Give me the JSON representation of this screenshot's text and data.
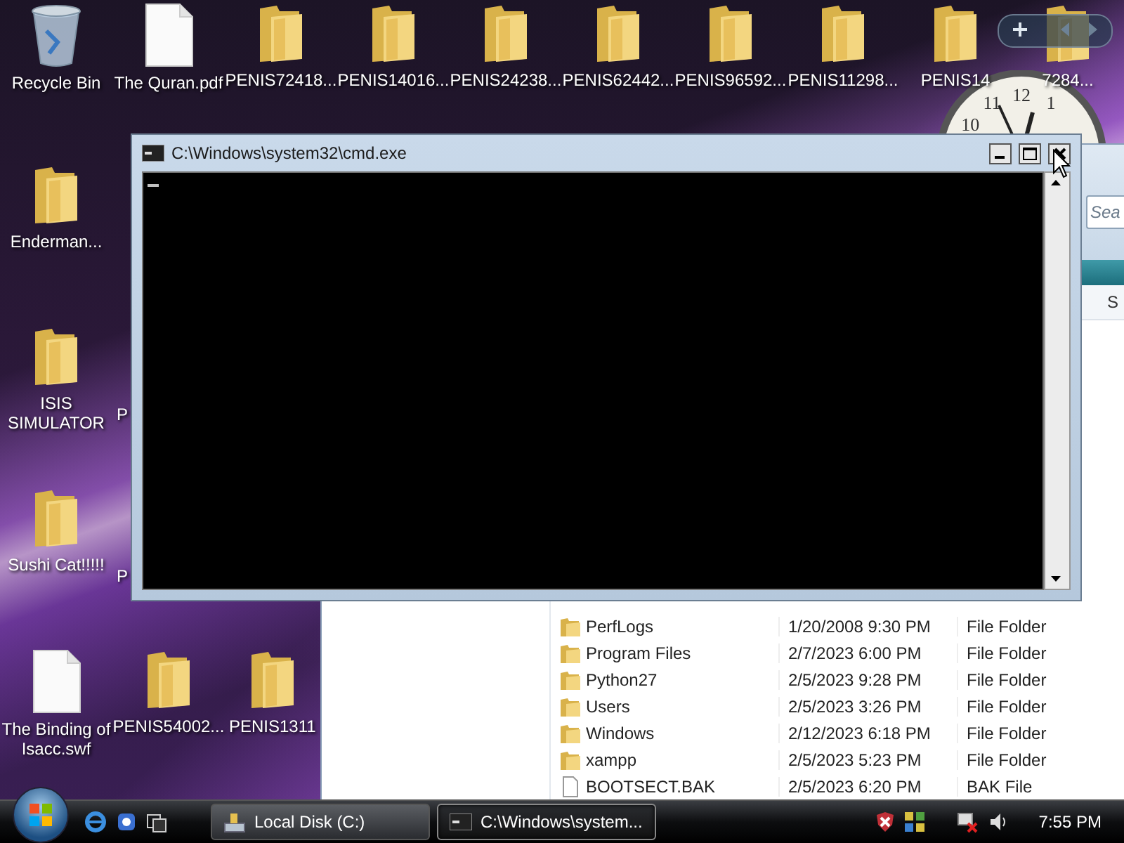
{
  "desktop": {
    "icons": [
      {
        "label": "Recycle Bin",
        "kind": "recycle"
      },
      {
        "label": "The Quran.pdf",
        "kind": "document"
      },
      {
        "label": "PENIS72418...",
        "kind": "folder"
      },
      {
        "label": "PENIS14016...",
        "kind": "folder"
      },
      {
        "label": "PENIS24238...",
        "kind": "folder"
      },
      {
        "label": "PENIS62442...",
        "kind": "folder"
      },
      {
        "label": "PENIS96592...",
        "kind": "folder"
      },
      {
        "label": "PENIS11298...",
        "kind": "folder"
      },
      {
        "label": "PENIS14",
        "kind": "folder"
      },
      {
        "label": "7284...",
        "kind": "folder"
      },
      {
        "label": "Enderman...",
        "kind": "folder"
      },
      {
        "label": "ISIS SIMULATOR",
        "kind": "folder"
      },
      {
        "label": "P",
        "kind": "covered"
      },
      {
        "label": "Sushi Cat!!!!!",
        "kind": "folder"
      },
      {
        "label": "P",
        "kind": "covered"
      },
      {
        "label": "The Binding of Isacc.swf",
        "kind": "document"
      },
      {
        "label": "PENIS54002...",
        "kind": "folder"
      },
      {
        "label": "PENIS1311",
        "kind": "cut-folder"
      }
    ]
  },
  "clock": {
    "numerals": [
      "12",
      "11",
      "1",
      "10"
    ]
  },
  "explorer": {
    "search": {
      "placeholder": "Sea"
    },
    "column_header": "S",
    "files": [
      {
        "name": "PerfLogs",
        "date": "1/20/2008 9:30 PM",
        "type": "File Folder",
        "kind": "folder"
      },
      {
        "name": "Program Files",
        "date": "2/7/2023 6:00 PM",
        "type": "File Folder",
        "kind": "folder"
      },
      {
        "name": "Python27",
        "date": "2/5/2023 9:28 PM",
        "type": "File Folder",
        "kind": "folder"
      },
      {
        "name": "Users",
        "date": "2/5/2023 3:26 PM",
        "type": "File Folder",
        "kind": "folder"
      },
      {
        "name": "Windows",
        "date": "2/12/2023 6:18 PM",
        "type": "File Folder",
        "kind": "folder"
      },
      {
        "name": "xampp",
        "date": "2/5/2023 5:23 PM",
        "type": "File Folder",
        "kind": "folder"
      },
      {
        "name": "BOOTSECT.BAK",
        "date": "2/5/2023 6:20 PM",
        "type": "BAK File",
        "kind": "file"
      }
    ]
  },
  "cmd": {
    "title": "C:\\Windows\\system32\\cmd.exe"
  },
  "taskbar": {
    "tasks": [
      {
        "label": "Local Disk (C:)",
        "kind": "explorer",
        "selected": false
      },
      {
        "label": "C:\\Windows\\system...",
        "kind": "cmd",
        "selected": true
      }
    ],
    "clock": "7:55 PM"
  }
}
